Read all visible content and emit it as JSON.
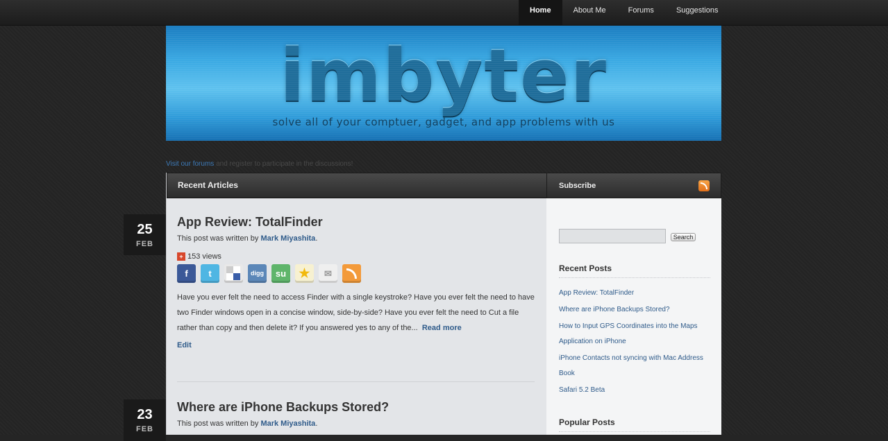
{
  "nav": {
    "items": [
      {
        "label": "Home",
        "active": true
      },
      {
        "label": "About Me",
        "active": false
      },
      {
        "label": "Forums",
        "active": false
      },
      {
        "label": "Suggestions",
        "active": false
      }
    ]
  },
  "banner": {
    "logo_text": "imbyter",
    "tagline": "solve all of your comptuer, gadget, and app problems with us"
  },
  "notice": {
    "link_text": "Visit our forums",
    "rest_text": " and register to participate in the discussions!"
  },
  "main": {
    "header": "Recent Articles",
    "posts": [
      {
        "day": "25",
        "month": "FEB",
        "title": "App Review: TotalFinder",
        "byline_prefix": "This post was written by ",
        "author": "Mark Miyashita",
        "byline_suffix": ".",
        "views": "153 views",
        "excerpt": "Have you ever felt the need to access Finder with a single keystroke? Have you ever felt the need to have two Finder windows open in a concise window, side-by-side? Have you ever felt the need to Cut a file rather than copy and then delete it? If you answered yes to any of the...",
        "read_more": "Read more",
        "edit": "Edit"
      },
      {
        "day": "23",
        "month": "FEB",
        "title": "Where are iPhone Backups Stored?",
        "byline_prefix": "This post was written by ",
        "author": "Mark Miyashita",
        "byline_suffix": "."
      }
    ],
    "social_icons": [
      "facebook-icon",
      "twitter-icon",
      "delicious-icon",
      "digg-icon",
      "stumbleupon-icon",
      "favorite-icon",
      "email-icon",
      "rss-icon"
    ]
  },
  "sidebar": {
    "header": "Subscribe",
    "search_button": "Search",
    "recent_posts_title": "Recent Posts",
    "recent_posts": [
      "App Review: TotalFinder",
      "Where are iPhone Backups Stored?",
      "How to Input GPS Coordinates into the Maps Application on iPhone",
      "iPhone Contacts not syncing with Mac Address Book",
      "Safari 5.2 Beta"
    ],
    "popular_posts_title": "Popular Posts"
  },
  "colors": {
    "link": "#2f5b8a",
    "banner_blue": "#3aa9e3",
    "rss_orange": "#e2701a"
  }
}
